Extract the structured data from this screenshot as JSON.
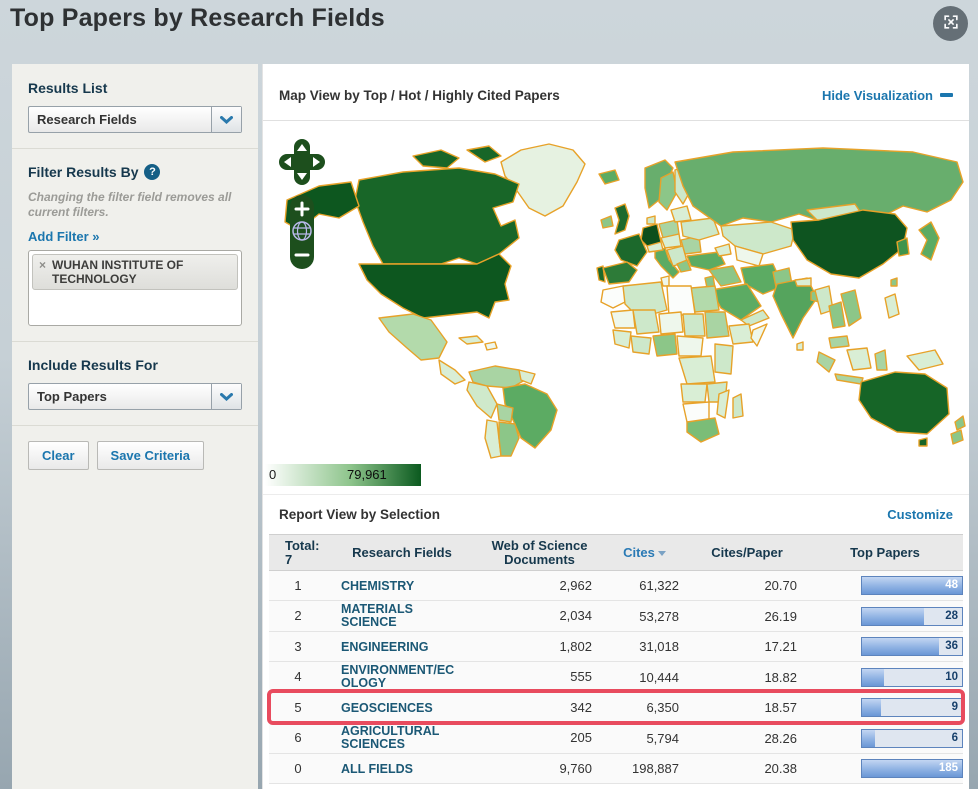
{
  "page": {
    "title": "Top Papers by Research Fields"
  },
  "sidebar": {
    "results_list": {
      "label": "Results List",
      "dropdown_value": "Research Fields"
    },
    "filter": {
      "heading": "Filter Results By",
      "help_icon": "question-mark-icon",
      "hint": "Changing the filter field removes all current filters.",
      "add_filter_label": "Add Filter »",
      "chips": [
        {
          "remove_glyph": "×",
          "label": "WUHAN INSTITUTE OF TECHNOLOGY"
        }
      ]
    },
    "include_results": {
      "heading": "Include Results For",
      "dropdown_value": "Top Papers"
    },
    "buttons": {
      "clear": "Clear",
      "save": "Save Criteria"
    }
  },
  "map": {
    "heading": "Map View by Top / Hot / Highly Cited Papers",
    "hide_link": "Hide Visualization",
    "legend": {
      "min": "0",
      "max": "79,961"
    }
  },
  "report": {
    "heading": "Report View by Selection",
    "customize_link": "Customize",
    "columns": {
      "total_label": "Total:",
      "total_count": "7",
      "field": "Research Fields",
      "docs": "Web of Science Documents",
      "cites": "Cites",
      "cpp": "Cites/Paper",
      "top_papers": "Top Papers"
    },
    "sorted_by": "Cites",
    "rows": [
      {
        "rank": "1",
        "field": "CHEMISTRY",
        "docs": "2,962",
        "cites": "61,322",
        "cpp": "20.70",
        "top_papers": "48",
        "bar_pct": 100,
        "highlighted": false
      },
      {
        "rank": "2",
        "field": "MATERIALS SCIENCE",
        "docs": "2,034",
        "cites": "53,278",
        "cpp": "26.19",
        "top_papers": "28",
        "bar_pct": 62,
        "highlighted": false
      },
      {
        "rank": "3",
        "field": "ENGINEERING",
        "docs": "1,802",
        "cites": "31,018",
        "cpp": "17.21",
        "top_papers": "36",
        "bar_pct": 77,
        "highlighted": false
      },
      {
        "rank": "4",
        "field": "ENVIRONMENT/ECOLOGY",
        "docs": "555",
        "cites": "10,444",
        "cpp": "18.82",
        "top_papers": "10",
        "bar_pct": 22,
        "highlighted": false
      },
      {
        "rank": "5",
        "field": "GEOSCIENCES",
        "docs": "342",
        "cites": "6,350",
        "cpp": "18.57",
        "top_papers": "9",
        "bar_pct": 19,
        "highlighted": true
      },
      {
        "rank": "6",
        "field": "AGRICULTURAL SCIENCES",
        "docs": "205",
        "cites": "5,794",
        "cpp": "28.26",
        "top_papers": "6",
        "bar_pct": 13,
        "highlighted": false
      },
      {
        "rank": "0",
        "field": "ALL FIELDS",
        "docs": "9,760",
        "cites": "198,887",
        "cpp": "20.38",
        "top_papers": "185",
        "bar_pct": 100,
        "highlighted": false
      }
    ]
  },
  "colors": {
    "link_blue": "#1B76AE",
    "field_link": "#1B5875",
    "highlight_red": "#E84B5E",
    "legend_dark_green": "#0B5A1F",
    "bar_blue": "#6D99D8",
    "map_border_orange": "#E7A229"
  }
}
